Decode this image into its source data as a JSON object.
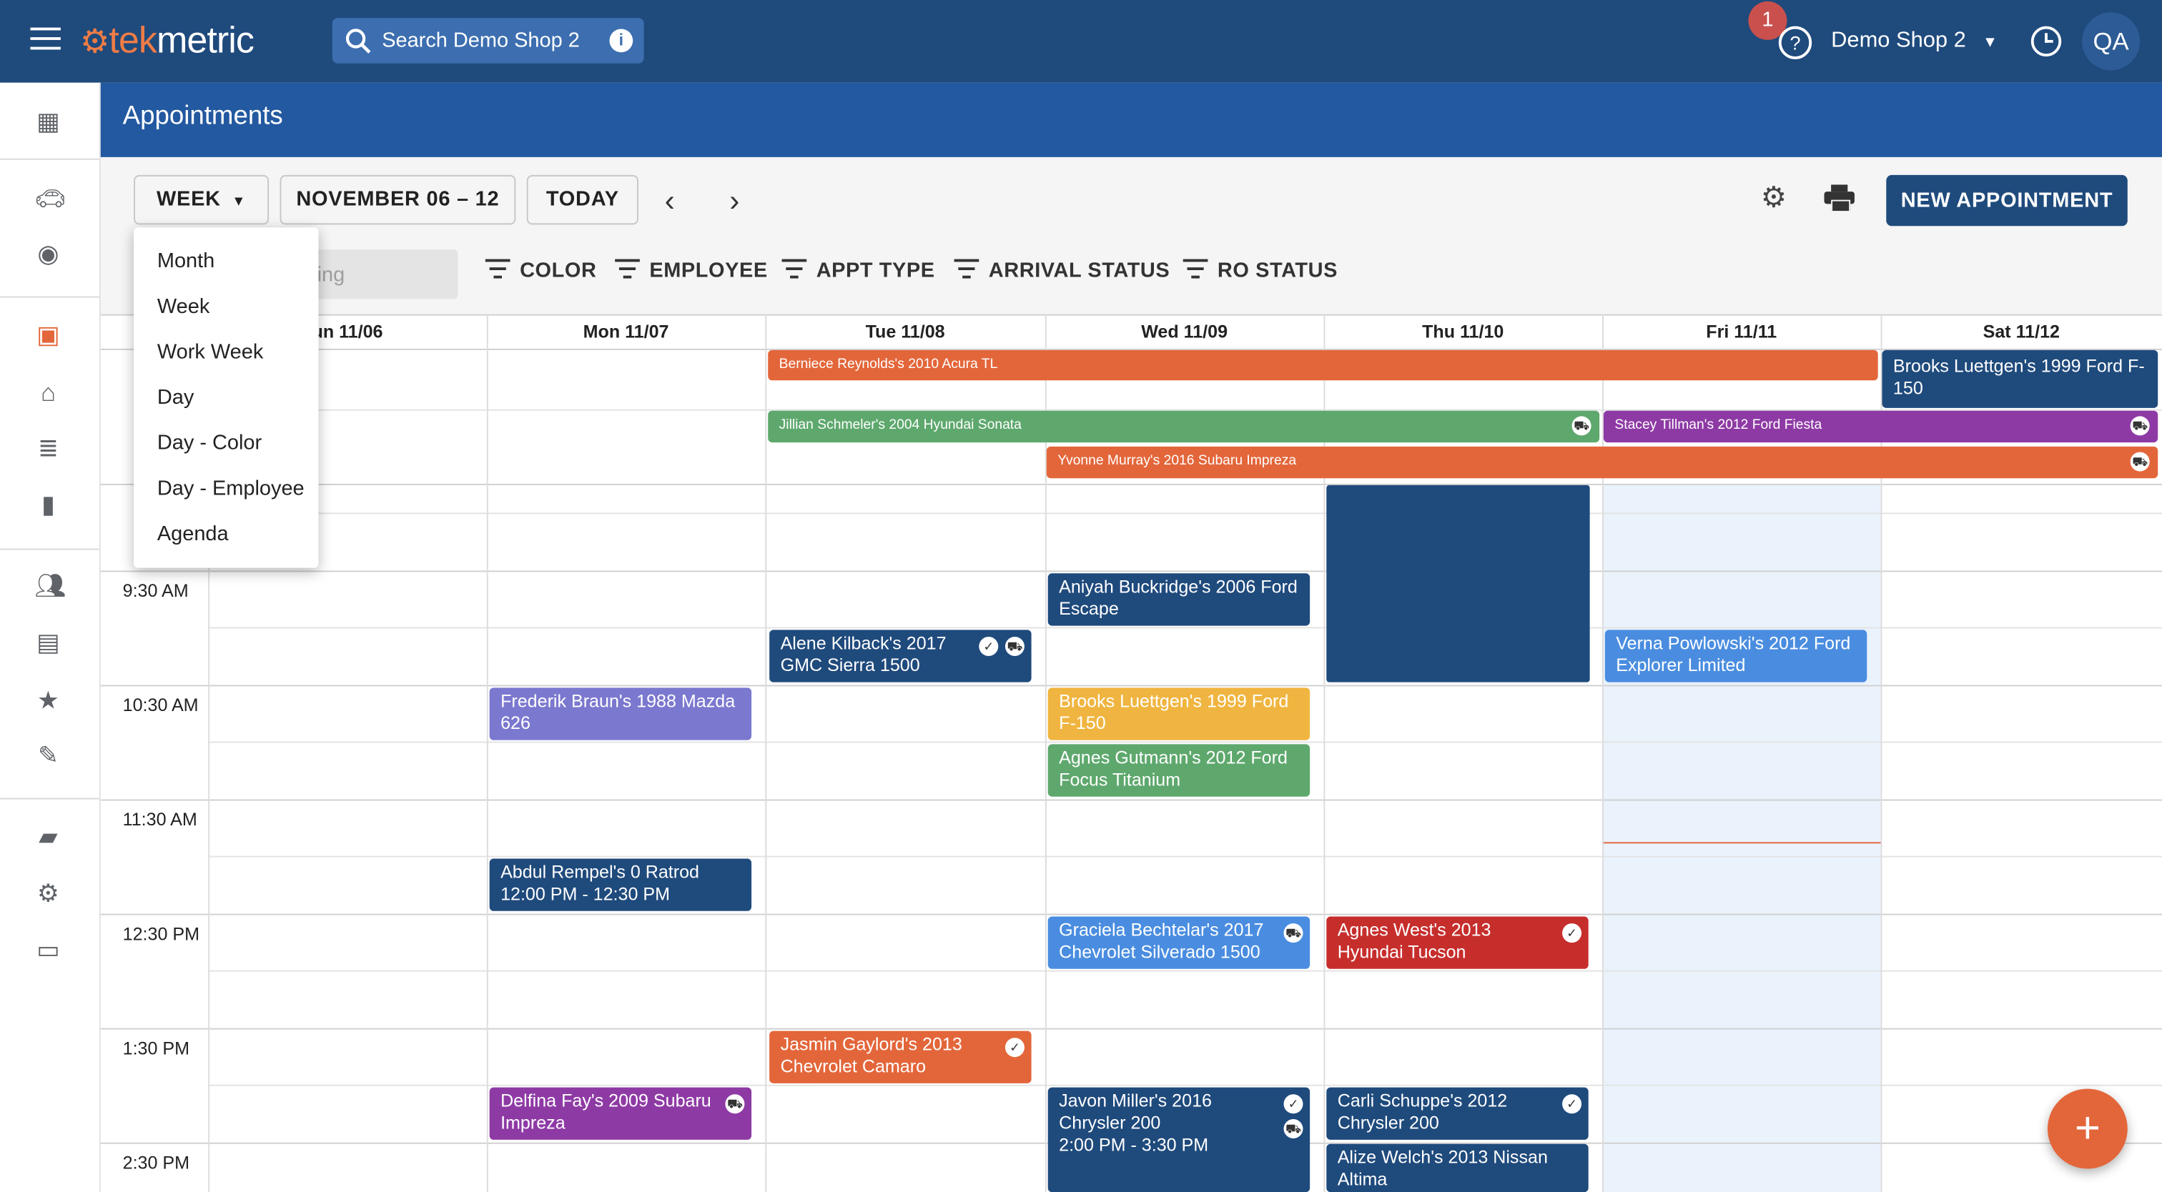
{
  "app": {
    "brand_prefix": "tek",
    "brand_suffix": "metric",
    "search_placeholder": "Search Demo Shop 2",
    "notification_count": "1",
    "shop_name": "Demo Shop 2",
    "user_initials": "QA"
  },
  "page": {
    "title": "Appointments"
  },
  "toolbar": {
    "view_label": "WEEK",
    "date_range": "NOVEMBER 06 – 12",
    "today_label": "TODAY",
    "new_appointment_label": "NEW APPOINTMENT",
    "search_placeholder_partial": "ing"
  },
  "filters": [
    "COLOR",
    "EMPLOYEE",
    "APPT TYPE",
    "ARRIVAL STATUS",
    "RO STATUS"
  ],
  "view_menu": [
    "Month",
    "Week",
    "Work Week",
    "Day",
    "Day - Color",
    "Day - Employee",
    "Agenda"
  ],
  "days": [
    "un 11/06",
    "Mon 11/07",
    "Tue 11/08",
    "Wed 11/09",
    "Thu 11/10",
    "Fri 11/11",
    "Sat 11/12"
  ],
  "times": [
    "9:30 AM",
    "10:30 AM",
    "11:30 AM",
    "12:30 PM",
    "1:30 PM",
    "2:30 PM"
  ],
  "all_day_events": [
    {
      "title": "Berniece Reynolds's 2010 Acura TL",
      "color": "#e3663a"
    },
    {
      "title": "Brooks Luettgen's 1999 Ford F-150",
      "color": "#1f4a7c"
    },
    {
      "title": "Jillian Schmeler's 2004 Hyundai Sonata",
      "color": "#5ea86d"
    },
    {
      "title": "Stacey Tillman's 2012 Ford Fiesta",
      "color": "#8e3aa5"
    },
    {
      "title": "Yvonne Murray's 2016 Subaru Impreza",
      "color": "#e3663a"
    }
  ],
  "events": [
    {
      "title": "Aniyah Buckridge's 2006 Ford Escape",
      "color": "#1f4a7c"
    },
    {
      "title": "Alene Kilback's 2017 GMC Sierra 1500",
      "color": "#1f4a7c"
    },
    {
      "title": "Verna Powlowski's 2012 Ford Explorer Limited",
      "color": "#4a8de0"
    },
    {
      "title": "Frederik Braun's 1988 Mazda 626",
      "color": "#7b78cf"
    },
    {
      "title": "Brooks Luettgen's 1999 Ford F-150",
      "color": "#f0b540"
    },
    {
      "title": "Agnes Gutmann's 2012 Ford Focus Titanium",
      "color": "#5ea86d"
    },
    {
      "title": "Abdul Rempel's 0 Ratrod",
      "time": "12:00 PM - 12:30 PM",
      "color": "#1f4a7c"
    },
    {
      "title": "Graciela Bechtelar's 2017 Chevrolet Silverado 1500",
      "color": "#4a8de0"
    },
    {
      "title": "Agnes West's 2013 Hyundai Tucson",
      "color": "#c62e2c"
    },
    {
      "title": "Jasmin Gaylord's 2013 Chevrolet Camaro",
      "color": "#e3663a"
    },
    {
      "title": "Delfina Fay's 2009 Subaru Impreza",
      "color": "#8e3aa5"
    },
    {
      "title": "Javon Miller's 2016 Chrysler 200",
      "time": "2:00 PM - 3:30 PM",
      "color": "#1f4a7c"
    },
    {
      "title": "Carli Schuppe's 2012 Chrysler 200",
      "color": "#1f4a7c"
    },
    {
      "title": "Alize Welch's 2013 Nissan Altima",
      "color": "#1f4a7c"
    }
  ]
}
